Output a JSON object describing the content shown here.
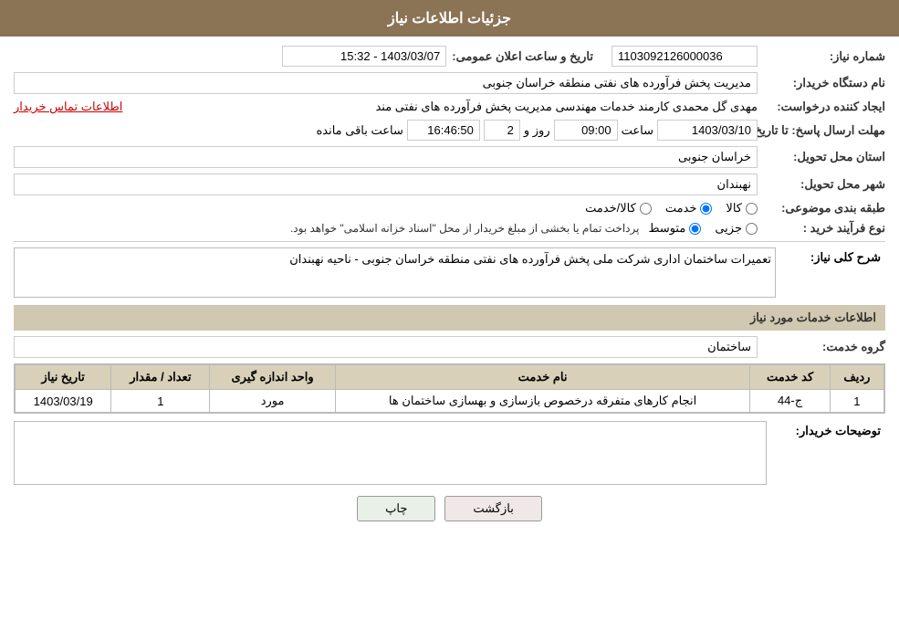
{
  "header": {
    "title": "جزئیات اطلاعات نیاز"
  },
  "fields": {
    "need_number_label": "شماره نیاز:",
    "need_number_value": "1103092126000036",
    "announce_date_label": "تاریخ و ساعت اعلان عمومی:",
    "announce_date_value": "1403/03/07 - 15:32",
    "buyer_name_label": "نام دستگاه خریدار:",
    "buyer_name_value": "مدیریت پخش فرآورده های نفتی منطقه خراسان جنوبی",
    "creator_label": "ایجاد کننده درخواست:",
    "creator_value": "مهدی گل محمدی کارمند خدمات مهندسی مدیریت پخش فرآورده های نفتی مند",
    "creator_link": "اطلاعات تماس خریدار",
    "send_date_label": "مهلت ارسال پاسخ: تا تاریخ:",
    "send_date_date": "1403/03/10",
    "send_date_time_label": "ساعت",
    "send_date_time": "09:00",
    "send_date_day_label": "روز و",
    "send_date_days": "2",
    "send_date_remain_label": "ساعت باقی مانده",
    "send_date_remain": "16:46:50",
    "province_label": "استان محل تحویل:",
    "province_value": "خراسان جنوبی",
    "city_label": "شهر محل تحویل:",
    "city_value": "نهبندان",
    "category_label": "طبقه بندی موضوعی:",
    "category_options": [
      {
        "label": "کالا",
        "value": "kala"
      },
      {
        "label": "خدمت",
        "value": "khedmat",
        "checked": true
      },
      {
        "label": "کالا/خدمت",
        "value": "kala_khedmat"
      }
    ],
    "purchase_type_label": "نوع فرآیند خرید :",
    "purchase_type_options": [
      {
        "label": "جزیی",
        "value": "jozii"
      },
      {
        "label": "متوسط",
        "value": "motavaset",
        "checked": true
      }
    ],
    "purchase_type_note": "پرداخت تمام یا بخشی از مبلغ خریدار از محل \"اسناد خزانه اسلامی\" خواهد بود.",
    "need_desc_label": "شرح کلی نیاز:",
    "need_desc_value": "تعمیرات ساختمان اداری شرکت ملی پخش فرآورده های نفتی منطقه خراسان جنوبی - ناحیه نهبندان",
    "services_section_label": "اطلاعات خدمات مورد نیاز",
    "service_group_label": "گروه خدمت:",
    "service_group_value": "ساختمان",
    "table": {
      "columns": [
        "ردیف",
        "کد خدمت",
        "نام خدمت",
        "واحد اندازه گیری",
        "تعداد / مقدار",
        "تاریخ نیاز"
      ],
      "rows": [
        {
          "row": "1",
          "code": "ج-44",
          "name": "انجام کارهای متفرقه درخصوص بازسازی و بهسازی ساختمان ها",
          "unit": "مورد",
          "quantity": "1",
          "date": "1403/03/19"
        }
      ]
    },
    "buyer_notes_label": "توضیحات خریدار:",
    "buyer_notes_value": ""
  },
  "buttons": {
    "print_label": "چاپ",
    "back_label": "بازگشت"
  }
}
